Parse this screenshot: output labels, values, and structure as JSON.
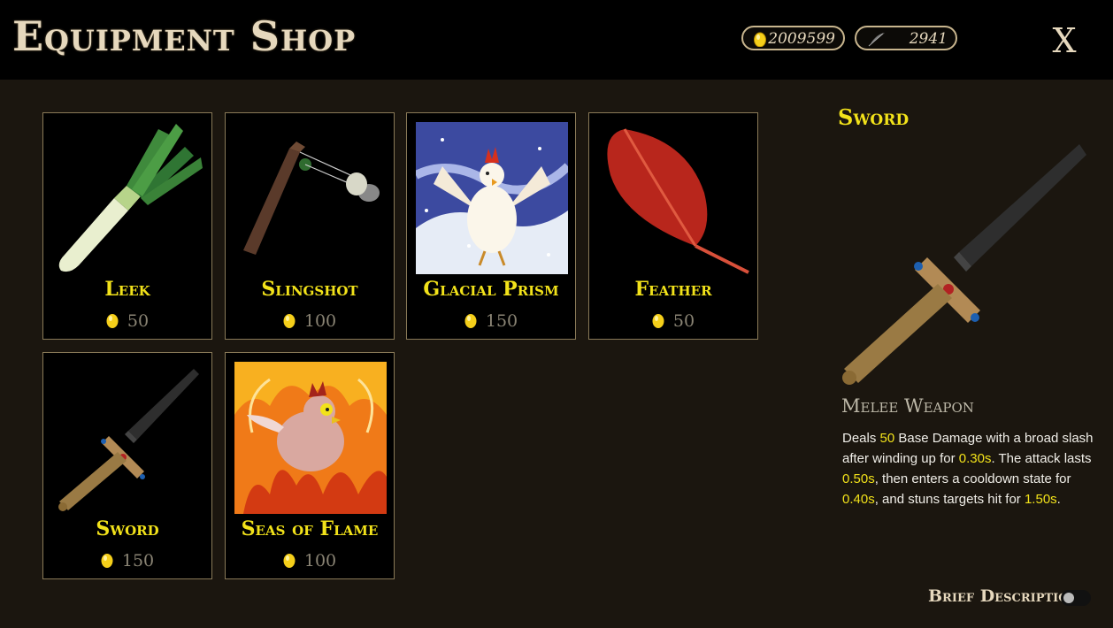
{
  "header": {
    "title": "Equipment Shop",
    "eggs": "2009599",
    "feathers": "2941",
    "close_label": "X"
  },
  "items": [
    {
      "name": "Leek",
      "price": "50",
      "icon": "leek-art"
    },
    {
      "name": "Slingshot",
      "price": "100",
      "icon": "slingshot-art"
    },
    {
      "name": "Glacial Prism",
      "price": "150",
      "icon": "glacial-prism-art"
    },
    {
      "name": "Feather",
      "price": "50",
      "icon": "feather-art"
    },
    {
      "name": "Sword",
      "price": "150",
      "icon": "sword-art"
    },
    {
      "name": "Seas of Flame",
      "price": "100",
      "icon": "seas-of-flame-art"
    }
  ],
  "detail": {
    "title": "Sword",
    "type": "Melee Weapon",
    "desc": {
      "p1": "Deals ",
      "damage": "50",
      "p2": " Base Damage with a broad slash after winding up for ",
      "windup": "0.30s",
      "p3": ". The attack lasts ",
      "duration": "0.50s",
      "p4": ", then enters a cooldown state for ",
      "cooldown": "0.40s",
      "p5": ", and stuns targets hit for ",
      "stun": "1.50s",
      "p6": "."
    }
  },
  "footer": {
    "brief_label": "Brief Description",
    "brief_on": false
  },
  "colors": {
    "accent_yellow": "#f2e21a",
    "border_tan": "#8a7a58",
    "text_cream": "#e6d8bd"
  }
}
